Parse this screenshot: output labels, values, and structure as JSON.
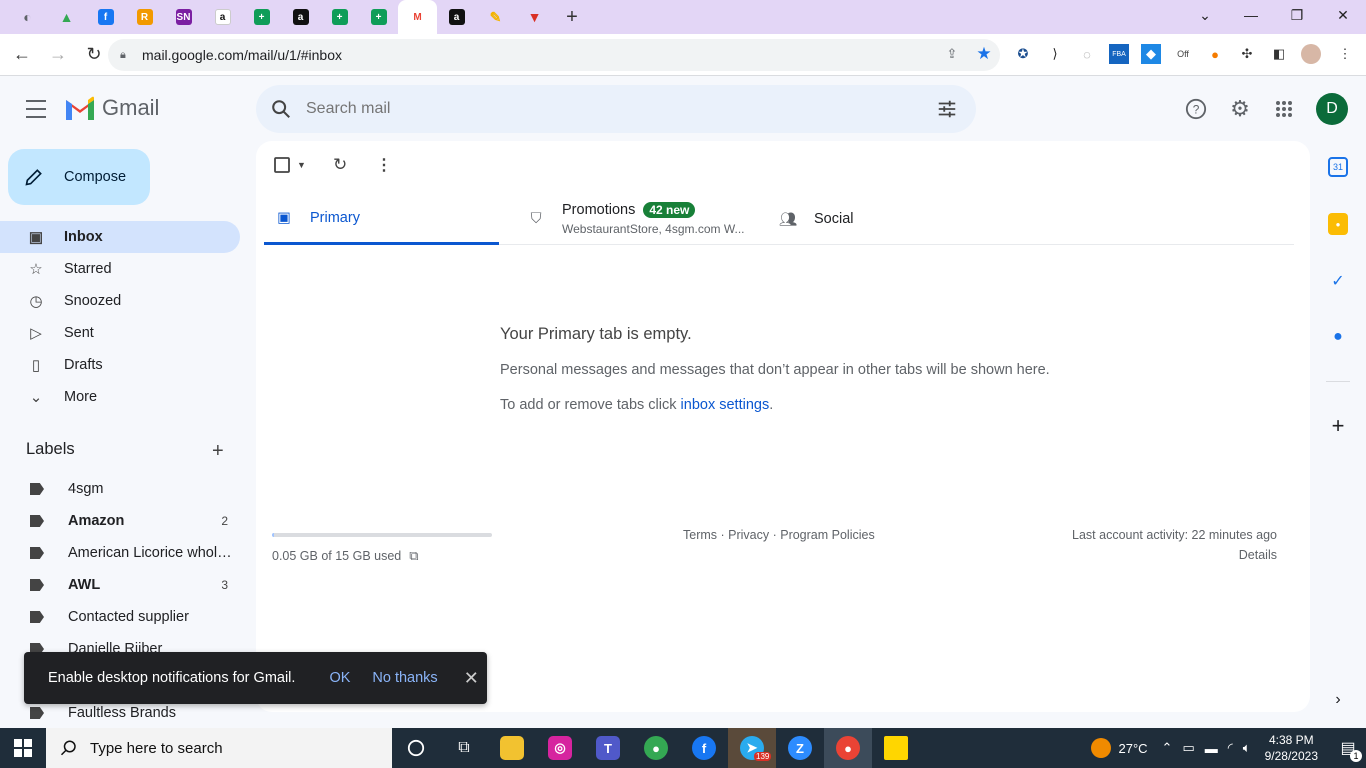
{
  "browser": {
    "tabs": [
      {
        "icon": "globe-icon",
        "color": "#5f6368",
        "glyph": "◐"
      },
      {
        "icon": "google-drive-icon",
        "color": "#34a853",
        "glyph": "▲"
      },
      {
        "icon": "facebook-icon",
        "color": "#1877f2",
        "glyph": "f"
      },
      {
        "icon": "r-app-icon",
        "color": "#f29900",
        "glyph": "R"
      },
      {
        "icon": "sn-icon",
        "color": "#7b1fa2",
        "glyph": "SN"
      },
      {
        "icon": "amazon-icon",
        "color": "#ffffff",
        "glyph": "a"
      },
      {
        "icon": "sheets-plus-icon",
        "color": "#0f9d58",
        "glyph": "+"
      },
      {
        "icon": "amazon-black-icon",
        "color": "#111111",
        "glyph": "a"
      },
      {
        "icon": "sheets-plus-icon",
        "color": "#0f9d58",
        "glyph": "+"
      },
      {
        "icon": "sheets-plus-icon",
        "color": "#0f9d58",
        "glyph": "+"
      },
      {
        "icon": "gmail-icon",
        "color": "#ffffff",
        "glyph": "M"
      },
      {
        "icon": "amazon-black-icon",
        "color": "#111111",
        "glyph": "a"
      },
      {
        "icon": "pencil-app-icon",
        "color": "#f4b400",
        "glyph": "✎"
      },
      {
        "icon": "red-v-icon",
        "color": "#d93025",
        "glyph": "▼"
      }
    ],
    "new_tab": "+",
    "url": "mail.google.com/mail/u/1/#inbox"
  },
  "gmail": {
    "product_name": "Gmail",
    "search_placeholder": "Search mail",
    "avatar_letter": "D",
    "compose_label": "Compose",
    "nav": [
      {
        "label": "Inbox",
        "icon": "inbox-icon",
        "glyph": "▣",
        "active": true
      },
      {
        "label": "Starred",
        "icon": "star-icon",
        "glyph": "☆"
      },
      {
        "label": "Snoozed",
        "icon": "clock-icon",
        "glyph": "◷"
      },
      {
        "label": "Sent",
        "icon": "send-icon",
        "glyph": "▷"
      },
      {
        "label": "Drafts",
        "icon": "draft-icon",
        "glyph": "▯"
      },
      {
        "label": "More",
        "icon": "chevron-down-icon",
        "glyph": "⌄"
      }
    ],
    "labels_heading": "Labels",
    "labels": [
      {
        "name": "4sgm",
        "count": "",
        "bold": false
      },
      {
        "name": "Amazon",
        "count": "2",
        "bold": true
      },
      {
        "name": "American Licorice whol…",
        "count": "",
        "bold": false
      },
      {
        "name": "AWL",
        "count": "3",
        "bold": true
      },
      {
        "name": "Contacted supplier",
        "count": "",
        "bold": false
      },
      {
        "name": "Danielle Rijber",
        "count": "",
        "bold": false
      },
      {
        "name": "Faultless Brands",
        "count": "",
        "bold": false
      }
    ],
    "inbox_tabs": {
      "primary": "Primary",
      "promotions": "Promotions",
      "promotions_badge": "42 new",
      "promotions_senders": "WebstaurantStore, 4sgm.com W...",
      "social": "Social"
    },
    "empty": {
      "title": "Your Primary tab is empty.",
      "description": "Personal messages and messages that don’t appear in other tabs will be shown here.",
      "hint_prefix": "To add or remove tabs click ",
      "hint_link": "inbox settings",
      "hint_suffix": "."
    },
    "storage": {
      "text": "0.05 GB of 15 GB used",
      "used_fraction": 0.003
    },
    "footer": {
      "terms": "Terms",
      "privacy": "Privacy",
      "policies": "Program Policies",
      "sep": " · ",
      "last_activity": "Last account activity: 22 minutes ago",
      "details": "Details"
    },
    "snackbar": {
      "message": "Enable desktop notifications for Gmail.",
      "ok": "OK",
      "no_thanks": "No thanks"
    },
    "side_panel": [
      {
        "icon": "calendar-icon",
        "color": "#1a73e8",
        "glyph": "31"
      },
      {
        "icon": "keep-icon",
        "color": "#fbbc04",
        "glyph": "●"
      },
      {
        "icon": "tasks-icon",
        "color": "#1a73e8",
        "glyph": "✓"
      },
      {
        "icon": "contacts-icon",
        "color": "#1a73e8",
        "glyph": "●"
      }
    ]
  },
  "taskbar": {
    "search_placeholder": "Type here to search",
    "temperature": "27°C",
    "time": "4:38 PM",
    "date": "9/28/2023",
    "telegram_badge": "139",
    "notification_count": "1"
  }
}
